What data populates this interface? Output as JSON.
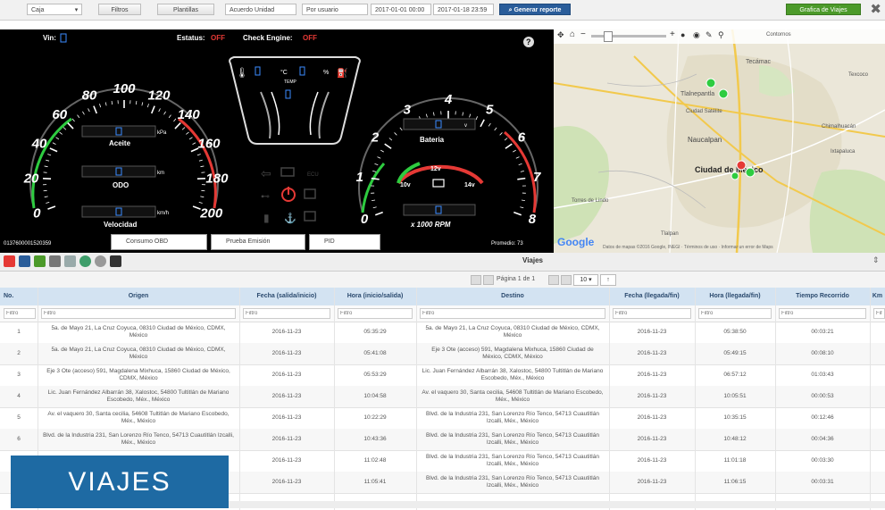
{
  "toolbar": {
    "unit_select": "Caja",
    "btn_filtros": "Filtros",
    "btn_plantillas": "Plantillas",
    "vehicle_select": "Acuerdo Unidad",
    "report_select": "Por usuario",
    "date_from": "2017-01-01 00:00",
    "date_to": "2017-01-18 23:59",
    "generate_label": "Generar reporte",
    "green_label": "Grafica de Viajes"
  },
  "dashboard": {
    "vin_label": "Vin:",
    "estatus_label": "Estatus:",
    "estatus_value": "OFF",
    "check_engine_label": "Check Engine:",
    "check_engine_value": "OFF",
    "speed_ticks": [
      "0",
      "20",
      "40",
      "60",
      "80",
      "100",
      "120",
      "140",
      "160",
      "180",
      "200"
    ],
    "rpm_ticks": [
      "0",
      "1",
      "2",
      "3",
      "4",
      "5",
      "6",
      "7",
      "8"
    ],
    "aceite_label": "Aceite",
    "aceite_unit": "kPa",
    "odo_label": "ODO",
    "odo_unit": "km",
    "velocidad_label": "Velocidad",
    "velocidad_unit": "km/h",
    "bateria_label": "Bateria",
    "bateria_unit": "v",
    "volt_10": "10v",
    "volt_12": "12v",
    "volt_14": "14v",
    "rpm_label": "x 1000 RPM",
    "temp_label": "TEMP",
    "temp_c": "°C",
    "fuel_pct": "%",
    "device_id": "0137600001520359",
    "promedio": "Promedio: 73",
    "tabs": [
      "Consumo OBD",
      "Prueba Emisión",
      "PID"
    ],
    "lamp_text": "ECU"
  },
  "map": {
    "labels": [
      "Tlalnepantla",
      "Ecatepec",
      "Ciudad Satélite",
      "Naucalpan",
      "Ciudad de México",
      "Chimalhuacán",
      "Ixtapaluca",
      "Tecámac",
      "Texcoco",
      "Tlalpan",
      "Torres de Lindo"
    ],
    "google": "Google",
    "attribution": "Datos de mapas ©2016 Google, INEGI · Términos de uso · Informar un error de Maps",
    "scale_label": "Contornos"
  },
  "viajes": {
    "title": "Viajes",
    "pager_text": "Página 1 de 1",
    "rows_per_page": "10",
    "columns": [
      "No.",
      "Origen",
      "Fecha (salida/inicio)",
      "Hora (inicio/salida)",
      "Destino",
      "Fecha (llegada/fin)",
      "Hora (llegada/fin)",
      "Tiempo Recorrido",
      "Km"
    ],
    "filter_placeholder": "Filtro",
    "rows": [
      {
        "no": "1",
        "origen": "5a. de Mayo 21, La Cruz Coyuca, 08310 Ciudad de México, CDMX, México",
        "fecha_ini": "2016-11-23",
        "hora_ini": "05:35:29",
        "destino": "5a. de Mayo 21, La Cruz Coyuca, 08310 Ciudad de México, CDMX, México",
        "fecha_fin": "2016-11-23",
        "hora_fin": "05:38:50",
        "tiempo": "00:03:21"
      },
      {
        "no": "2",
        "origen": "5a. de Mayo 21, La Cruz Coyuca, 08310 Ciudad de México, CDMX, México",
        "fecha_ini": "2016-11-23",
        "hora_ini": "05:41:08",
        "destino": "Eje 3 Ote (acceso) 591, Magdalena Mixhuca, 15860 Ciudad de México, CDMX, México",
        "fecha_fin": "2016-11-23",
        "hora_fin": "05:49:15",
        "tiempo": "00:08:10"
      },
      {
        "no": "3",
        "origen": "Eje 3 Ote (acceso) 591, Magdalena Mixhuca, 15860 Ciudad de México, CDMX, México",
        "fecha_ini": "2016-11-23",
        "hora_ini": "05:53:29",
        "destino": "Lic. Juan Fernández Albarrán 38, Xalostoc, 54800 Tultitlán de Mariano Escobedo, Méx., México",
        "fecha_fin": "2016-11-23",
        "hora_fin": "06:57:12",
        "tiempo": "01:03:43"
      },
      {
        "no": "4",
        "origen": "Lic. Juan Fernández Albarrán 38, Xalostoc, 54800 Tultitlán de Mariano Escobedo, Méx., México",
        "fecha_ini": "2016-11-23",
        "hora_ini": "10:04:58",
        "destino": "Av. el vaquero 30, Santa cecilia, 54608 Tultitlán de Mariano Escobedo, Méx., México",
        "fecha_fin": "2016-11-23",
        "hora_fin": "10:05:51",
        "tiempo": "00:00:53"
      },
      {
        "no": "5",
        "origen": "Av. el vaquero 30, Santa cecilia, 54608 Tultitlán de Mariano Escobedo, Méx., México",
        "fecha_ini": "2016-11-23",
        "hora_ini": "10:22:29",
        "destino": "Blvd. de la Industria 231, San Lorenzo Río Tenco, 54713 Cuautitlán Izcalli, Méx., México",
        "fecha_fin": "2016-11-23",
        "hora_fin": "10:35:15",
        "tiempo": "00:12:46"
      },
      {
        "no": "6",
        "origen": "Blvd. de la Industria 231, San Lorenzo Río Tenco, 54713 Cuautitlán Izcalli, Méx., México",
        "fecha_ini": "2016-11-23",
        "hora_ini": "10:43:36",
        "destino": "Blvd. de la Industria 231, San Lorenzo Río Tenco, 54713 Cuautitlán Izcalli, Méx., México",
        "fecha_fin": "2016-11-23",
        "hora_fin": "10:48:12",
        "tiempo": "00:04:36"
      },
      {
        "no": "7",
        "origen": "",
        "fecha_ini": "2016-11-23",
        "hora_ini": "11:02:48",
        "destino": "Blvd. de la Industria 231, San Lorenzo Río Tenco, 54713 Cuautitlán Izcalli, Méx., México",
        "fecha_fin": "2016-11-23",
        "hora_fin": "11:01:18",
        "tiempo": "00:03:30"
      },
      {
        "no": "8",
        "origen": "",
        "fecha_ini": "2016-11-23",
        "hora_ini": "11:05:41",
        "destino": "Blvd. de la Industria 231, San Lorenzo Río Tenco, 54713 Cuautitlán Izcalli, Méx., México",
        "fecha_fin": "2016-11-23",
        "hora_fin": "11:06:15",
        "tiempo": "00:03:31"
      }
    ]
  },
  "banner": {
    "text": "VIAJES"
  },
  "colors": {
    "accent": "#2a5d9a",
    "green": "#4c9a2a",
    "banner": "#1e6aa3",
    "header": "#d3e3f2",
    "danger": "#e53935",
    "gauge_green": "#2ecc40"
  }
}
